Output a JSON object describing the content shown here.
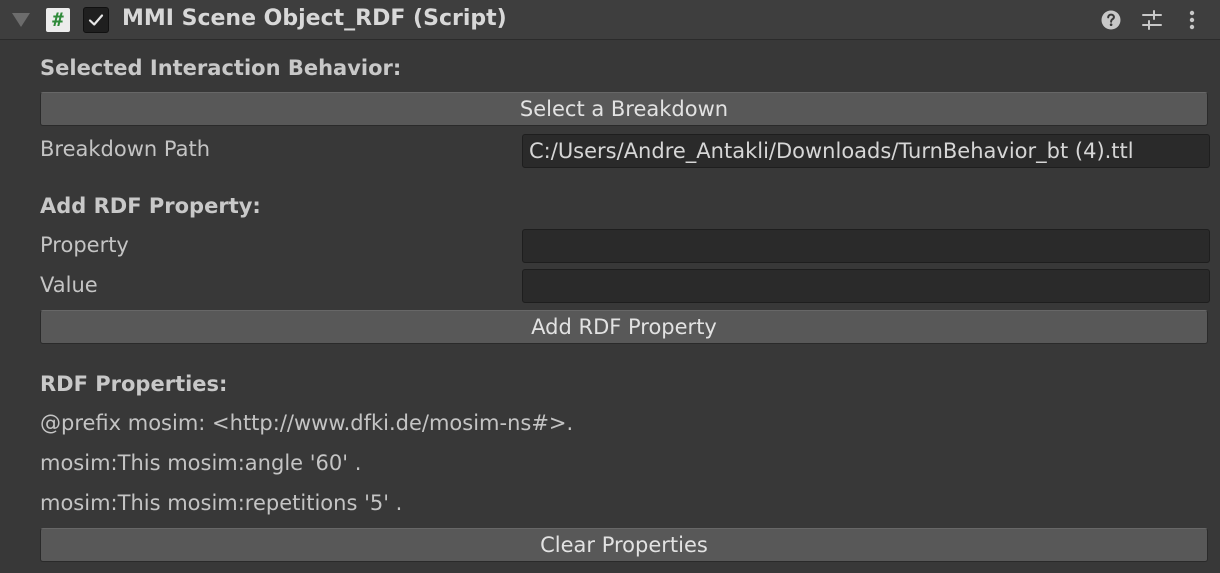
{
  "header": {
    "title": "MMI Scene Object_RDF (Script)",
    "script_icon_glyph": "#",
    "enabled": true,
    "icons": [
      "help-icon",
      "presets-icon",
      "more-icon"
    ]
  },
  "interaction": {
    "section_label": "Selected Interaction Behavior:",
    "select_button_label": "Select a Breakdown",
    "path_label": "Breakdown Path",
    "path_value": "C:/Users/Andre_Antakli/Downloads/TurnBehavior_bt (4).ttl"
  },
  "add_property": {
    "section_label": "Add RDF Property:",
    "property_label": "Property",
    "property_value": "",
    "value_label": "Value",
    "value_value": "",
    "add_button_label": "Add RDF Property"
  },
  "properties": {
    "section_label": "RDF Properties:",
    "lines": [
      "@prefix mosim: <http://www.dfki.de/mosim-ns#>.",
      "mosim:This mosim:angle '60' .",
      "mosim:This mosim:repetitions '5' ."
    ],
    "clear_button_label": "Clear Properties"
  },
  "colors": {
    "background": "#383838",
    "header": "#3e3e3e",
    "button": "#585858",
    "field": "#2a2a2a",
    "script_icon_hash": "#2f8a3a"
  }
}
